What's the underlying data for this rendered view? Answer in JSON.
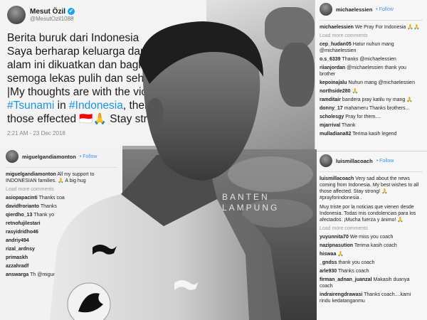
{
  "tweet": {
    "name": "Mesut Özil",
    "handle": "@MesutOzil1088",
    "body_line1": "Berita buruk dari Indonesia",
    "body_line2": "Saya berharap keluarga dari ko",
    "body_line3": "alam ini dikuatkan dan bagi y",
    "body_line4": "semoga lekas pulih dan sehat",
    "body_line5": "|My thoughts are with the vict",
    "body_hash1": "#Tsunami",
    "body_in": " in ",
    "body_hash2": "#Indonesia",
    "body_line6_tail": ", their",
    "body_line7": "those effected 🇮🇩🙏 Stay strong",
    "time": "2:21 AM - 23 Dec 2018"
  },
  "ig_top": {
    "user": "michaelessien",
    "follow": "Follow",
    "caption_user": "michaelessien",
    "caption": "We Pray For Indonesia 🙏🙏",
    "load_more": "Load more comments",
    "comments": [
      {
        "user": "cep_hudan05",
        "text": "Hatur nuhun mang @michaelessien"
      },
      {
        "user": "o.s_6339",
        "text": "Thanks @michaelessien"
      },
      {
        "user": "riianjordan",
        "text": "@michaelessien thank you brother"
      },
      {
        "user": "kepoinajalu",
        "text": "Nuhun mang @michaelessien"
      },
      {
        "user": "northside280",
        "text": "🙏"
      },
      {
        "user": "ramditair",
        "text": "bandera pray katilu ny mang 🙏"
      },
      {
        "user": "donny_17",
        "text": "mahameru Thanks brothers..."
      },
      {
        "user": "scholesgy",
        "text": "Pray for them...."
      },
      {
        "user": "mjarrival",
        "text": "Thank"
      },
      {
        "user": "mulladiana82",
        "text": "Terima kasih legend"
      }
    ]
  },
  "ig_bottom": {
    "user": "luismillacoach",
    "follow": "Follow",
    "caption_user": "luismillacoach",
    "caption": "Very sad about the news coming from Indonesia. My best wishes to all those affected. Stay strong! 🙏 #prayforindonesia .",
    "caption_es": "Muy triste por la noticias que vienen desde Indonesia. Todas mis condolencias para los afectados. ¡Mucha fuerza y ánimo! 🙏",
    "load_more": "Load more comments",
    "comments": [
      {
        "user": "yuyunnita70",
        "text": "We miss you coach"
      },
      {
        "user": "nazipnasution",
        "text": "Terima kasih coach"
      },
      {
        "user": "hiswaa",
        "text": "🙏"
      },
      {
        "user": "_gndss",
        "text": "thank you coach"
      },
      {
        "user": "arle930",
        "text": "Thanks coach"
      },
      {
        "user": "firman_adnan_juanzal",
        "text": "Makasih duanya coach"
      },
      {
        "user": "indrairengdrawasi",
        "text": "Thanks coach....kami rindu kedatanganmu"
      }
    ]
  },
  "ig_left": {
    "user": "miguelgandiamonton",
    "follow": "Follow",
    "caption_user": "miguelgandiamonton",
    "caption": "All my support to INDONESIAN families. 🙏 A big hug",
    "load_more": "Load more comments",
    "comments": [
      {
        "user": "asiopapacinti",
        "text": "Thanks coa"
      },
      {
        "user": "davidfrorianto",
        "text": "Thanks"
      },
      {
        "user": "qierdho_13",
        "text": "Thank yo"
      },
      {
        "user": "retnofujilestari",
        "text": ""
      },
      {
        "user": "rasyidridho46",
        "text": ""
      },
      {
        "user": "andriy494",
        "text": ""
      },
      {
        "user": "rizal_ardnsy",
        "text": ""
      },
      {
        "user": "primaskh",
        "text": ""
      },
      {
        "user": "azzahradf",
        "text": ""
      },
      {
        "user": "answarga",
        "text": "Th @miguelgan"
      }
    ]
  },
  "watermark": {
    "line1": "BANTEN",
    "line2": "LAMPUNG"
  },
  "colors": {
    "link": "#3897f0",
    "hashtag": "#1b95e0",
    "verified": "#1da1f2"
  }
}
